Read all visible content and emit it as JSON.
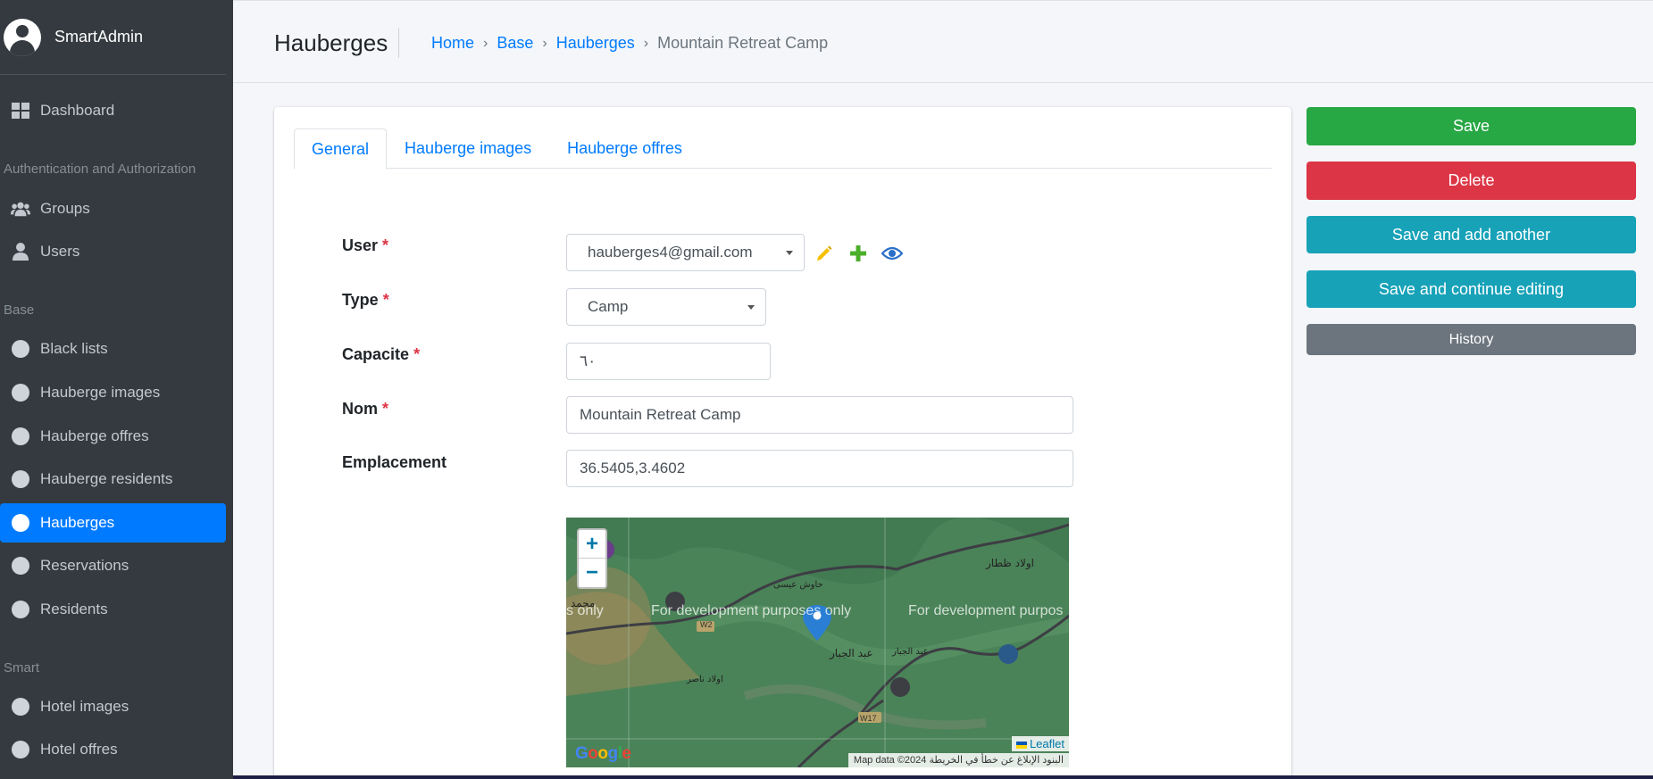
{
  "brand": {
    "name": "SmartAdmin"
  },
  "sidebar": {
    "dashboard": "Dashboard",
    "section_auth": "Authentication and Authorization",
    "groups": "Groups",
    "users": "Users",
    "section_base": "Base",
    "black_lists": "Black lists",
    "hauberge_images": "Hauberge images",
    "hauberge_offres": "Hauberge offres",
    "hauberge_residents": "Hauberge residents",
    "hauberges": "Hauberges",
    "reservations": "Reservations",
    "residents": "Residents",
    "section_smart": "Smart",
    "hotel_images": "Hotel images",
    "hotel_offres": "Hotel offres"
  },
  "header": {
    "title": "Hauberges",
    "breadcrumb": [
      "Home",
      "Base",
      "Hauberges",
      "Mountain Retreat Camp"
    ],
    "separator": "›"
  },
  "tabs": [
    "General",
    "Hauberge images",
    "Hauberge offres"
  ],
  "form": {
    "user_label": "User",
    "user_value": "hauberges4@gmail.com",
    "type_label": "Type",
    "type_value": "Camp",
    "capacite_label": "Capacite",
    "capacite_value": "٦٠",
    "nom_label": "Nom",
    "nom_value": "Mountain Retreat Camp",
    "emplacement_label": "Emplacement",
    "emplacement_value": "36.5405,3.4602",
    "required_mark": "*"
  },
  "map": {
    "zoom_in": "+",
    "zoom_out": "−",
    "watermark": "For development purposes only",
    "watermark_left": "s only",
    "watermark_right": "For development purpos",
    "leaflet": "Leaflet",
    "attribution": "Map data ©2024  البنود  الإبلاغ عن خطأ في الخريطة",
    "google": "Google",
    "place_labels": [
      "اولاد ظطار",
      "عبد الجبار",
      "عبد الجبار",
      "حاوش عيسى",
      "اولاد ناصر",
      "محمد",
      "W2",
      "W17"
    ]
  },
  "actions": {
    "save": "Save",
    "delete": "Delete",
    "save_add": "Save and add another",
    "save_continue": "Save and continue editing",
    "history": "History"
  },
  "colors": {
    "sidebar_bg": "#343a40",
    "primary": "#007bff",
    "success": "#28a745",
    "danger": "#dc3545",
    "info": "#17a2b8",
    "secondary": "#6c757d"
  }
}
